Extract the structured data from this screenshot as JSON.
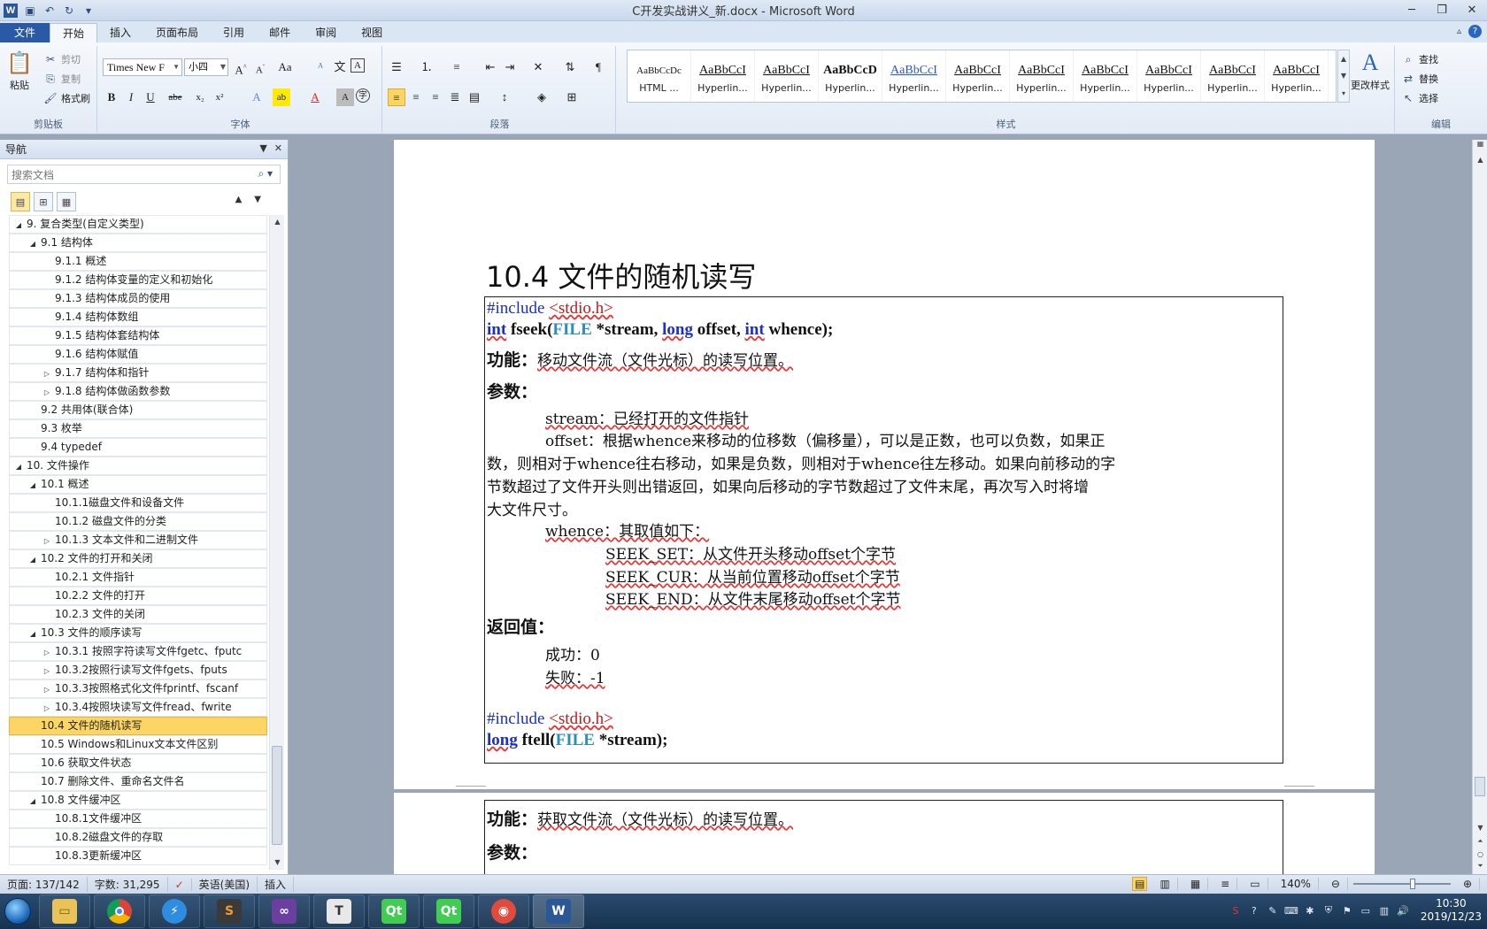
{
  "window": {
    "title": "C开发实战讲义_新.docx - Microsoft Word",
    "app_icon": "W"
  },
  "ribbon_tabs": [
    "文件",
    "开始",
    "插入",
    "页面布局",
    "引用",
    "邮件",
    "审阅",
    "视图"
  ],
  "clipboard": {
    "paste": "粘贴",
    "cut": "剪切",
    "copy": "复制",
    "format_painter": "格式刷",
    "group": "剪贴板"
  },
  "font": {
    "name": "Times New F",
    "size": "小四",
    "group": "字体"
  },
  "paragraph_group": "段落",
  "styles": {
    "group": "样式",
    "change_styles": "更改样式",
    "items": [
      {
        "preview": "AaBbCcDc",
        "name": "HTML ..."
      },
      {
        "preview": "AaBbCcI",
        "name": "Hyperlin..."
      },
      {
        "preview": "AaBbCcI",
        "name": "Hyperlin..."
      },
      {
        "preview": "AaBbCcD",
        "name": "Hyperlin..."
      },
      {
        "preview": "AaBbCcI",
        "name": "Hyperlin..."
      },
      {
        "preview": "AaBbCcI",
        "name": "Hyperlin..."
      },
      {
        "preview": "AaBbCcI",
        "name": "Hyperlin..."
      },
      {
        "preview": "AaBbCcI",
        "name": "Hyperlin..."
      },
      {
        "preview": "AaBbCcI",
        "name": "Hyperlin..."
      },
      {
        "preview": "AaBbCcI",
        "name": "Hyperlin..."
      },
      {
        "preview": "AaBbCcI",
        "name": "Hyperlin..."
      }
    ]
  },
  "editing": {
    "find": "查找",
    "replace": "替换",
    "select": "选择",
    "group": "编辑"
  },
  "navigation": {
    "title": "导航",
    "search_placeholder": "搜索文档",
    "tree": [
      {
        "level": 0,
        "toggle": "◢",
        "text": "9. 复合类型(自定义类型)"
      },
      {
        "level": 1,
        "toggle": "◢",
        "text": "9.1 结构体"
      },
      {
        "level": 2,
        "toggle": "",
        "text": "9.1.1 概述"
      },
      {
        "level": 2,
        "toggle": "",
        "text": "9.1.2 结构体变量的定义和初始化"
      },
      {
        "level": 2,
        "toggle": "",
        "text": "9.1.3 结构体成员的使用"
      },
      {
        "level": 2,
        "toggle": "",
        "text": "9.1.4 结构体数组"
      },
      {
        "level": 2,
        "toggle": "",
        "text": "9.1.5 结构体套结构体"
      },
      {
        "level": 2,
        "toggle": "",
        "text": "9.1.6 结构体赋值"
      },
      {
        "level": 2,
        "toggle": "▷",
        "text": "9.1.7 结构体和指针"
      },
      {
        "level": 2,
        "toggle": "▷",
        "text": "9.1.8 结构体做函数参数"
      },
      {
        "level": 1,
        "toggle": "",
        "text": "9.2 共用体(联合体)"
      },
      {
        "level": 1,
        "toggle": "",
        "text": "9.3 枚举"
      },
      {
        "level": 1,
        "toggle": "",
        "text": "9.4 typedef"
      },
      {
        "level": 0,
        "toggle": "◢",
        "text": "10. 文件操作"
      },
      {
        "level": 1,
        "toggle": "◢",
        "text": "10.1 概述"
      },
      {
        "level": 2,
        "toggle": "",
        "text": "10.1.1磁盘文件和设备文件"
      },
      {
        "level": 2,
        "toggle": "",
        "text": "10.1.2 磁盘文件的分类"
      },
      {
        "level": 2,
        "toggle": "▷",
        "text": "10.1.3 文本文件和二进制文件"
      },
      {
        "level": 1,
        "toggle": "◢",
        "text": "10.2 文件的打开和关闭"
      },
      {
        "level": 2,
        "toggle": "",
        "text": "10.2.1 文件指针"
      },
      {
        "level": 2,
        "toggle": "",
        "text": "10.2.2 文件的打开"
      },
      {
        "level": 2,
        "toggle": "",
        "text": "10.2.3 文件的关闭"
      },
      {
        "level": 1,
        "toggle": "◢",
        "text": "10.3 文件的顺序读写"
      },
      {
        "level": 2,
        "toggle": "▷",
        "text": "10.3.1 按照字符读写文件fgetc、fputc"
      },
      {
        "level": 2,
        "toggle": "▷",
        "text": "10.3.2按照行读写文件fgets、fputs"
      },
      {
        "level": 2,
        "toggle": "▷",
        "text": "10.3.3按照格式化文件fprintf、fscanf"
      },
      {
        "level": 2,
        "toggle": "▷",
        "text": "10.3.4按照块读写文件fread、fwrite"
      },
      {
        "level": 1,
        "toggle": "",
        "text": "10.4 文件的随机读写",
        "selected": true
      },
      {
        "level": 1,
        "toggle": "",
        "text": "10.5 Windows和Linux文本文件区别"
      },
      {
        "level": 1,
        "toggle": "",
        "text": "10.6 获取文件状态"
      },
      {
        "level": 1,
        "toggle": "",
        "text": "10.7 删除文件、重命名文件名"
      },
      {
        "level": 1,
        "toggle": "◢",
        "text": "10.8 文件缓冲区"
      },
      {
        "level": 2,
        "toggle": "",
        "text": "10.8.1文件缓冲区"
      },
      {
        "level": 2,
        "toggle": "",
        "text": "10.8.2磁盘文件的存取"
      },
      {
        "level": 2,
        "toggle": "",
        "text": "10.8.3更新缓冲区"
      }
    ]
  },
  "document": {
    "heading": "10.4 文件的随机读写",
    "include1": "#include",
    "include1_file": "<stdio.h>",
    "fseek_sig": {
      "int1": "int",
      "name": "fseek(",
      "file": "FILE",
      "p1": "*stream,",
      "long": "long",
      "p2": "offset,",
      "int2": "int",
      "p3": "whence);"
    },
    "func_label": "功能：",
    "fseek_desc": "移动文件流（文件光标）的读写位置。",
    "params_label": "参数：",
    "stream_desc": "stream：已经打开的文件指针",
    "offset_line1": "offset：根据whence来移动的位移数（偏移量），可以是正数，也可以负数，如果正",
    "offset_line2": "数，则相对于whence往右移动，如果是负数，则相对于whence往左移动。如果向前移动的字",
    "offset_line3": "节数超过了文件开头则出错返回，如果向后移动的字节数超过了文件末尾，再次写入时将增",
    "offset_line4": "大文件尺寸。",
    "whence_desc": "whence：其取值如下：",
    "seek_set": "SEEK_SET：从文件开头移动offset个字节",
    "seek_cur": "SEEK_CUR：从当前位置移动offset个字节",
    "seek_end": "SEEK_END：从文件末尾移动offset个字节",
    "return_label": "返回值：",
    "success": "成功：0",
    "fail": "失败：-1",
    "include2": "#include",
    "include2_file": "<stdio.h>",
    "ftell_sig": {
      "long": "long",
      "name": "ftell(",
      "file": "FILE",
      "p1": "*stream);"
    },
    "ftell_desc": "获取文件流（文件光标）的读写位置。"
  },
  "statusbar": {
    "page": "页面: 137/142",
    "words": "字数: 31,295",
    "language": "英语(美国)",
    "mode": "插入",
    "zoom": "140%"
  },
  "taskbar": {
    "time": "10:30",
    "date": "2019/12/23"
  },
  "colors": {
    "keyword": "#1a2fd0",
    "type": "#2a8fb8",
    "include_file": "#c41a1a",
    "nav_selected": "#fcd663",
    "file_tab": "#2a5aa6"
  }
}
